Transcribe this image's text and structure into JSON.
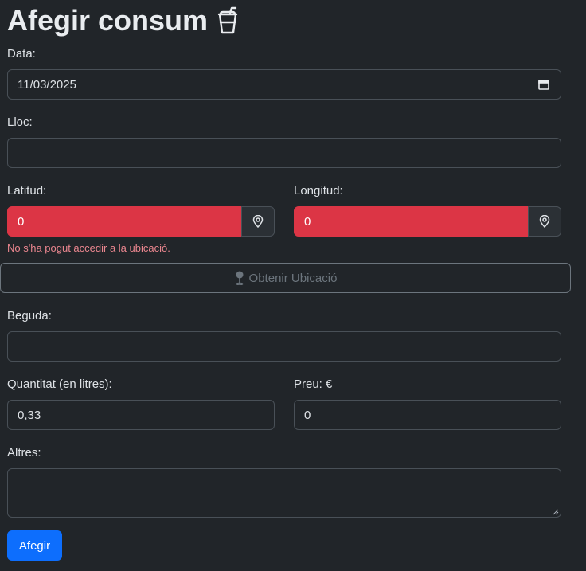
{
  "page": {
    "title": "Afegir consum",
    "title_icon": "cup-straw-icon"
  },
  "form": {
    "date": {
      "label": "Data:",
      "value": "11/03/2025",
      "icon": "calendar-icon"
    },
    "place": {
      "label": "Lloc:",
      "value": ""
    },
    "latitude": {
      "label": "Latitud:",
      "value": "0",
      "icon": "geo-alt-icon"
    },
    "longitude": {
      "label": "Longitud:",
      "value": "0",
      "icon": "geo-alt-icon"
    },
    "location_error": "No s'ha pogut accedir a la ubicació.",
    "get_location_button": {
      "label": "Obtenir Ubicació",
      "icon": "pin-icon"
    },
    "drink": {
      "label": "Beguda:",
      "value": ""
    },
    "quantity": {
      "label": "Quantitat (en litres):",
      "value": "0,33"
    },
    "price": {
      "label": "Preu: €",
      "value": "0"
    },
    "other": {
      "label": "Altres:",
      "value": ""
    },
    "submit_button": {
      "label": "Afegir"
    }
  },
  "colors": {
    "background": "#212529",
    "invalid_field": "#dc3545",
    "primary": "#0d6efd",
    "error_text": "#ea868f",
    "secondary": "#6c757d"
  }
}
